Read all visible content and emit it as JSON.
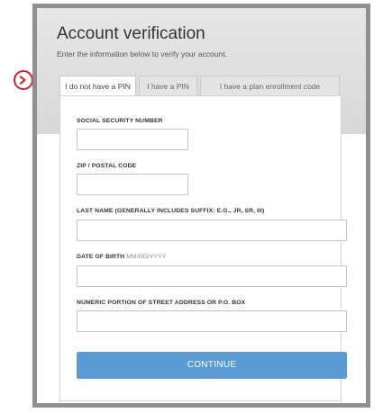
{
  "header": {
    "title": "Account verification",
    "subtitle": "Enter the information below to verify your account."
  },
  "tabs": [
    {
      "label": "I do not have a PIN",
      "active": true
    },
    {
      "label": "I have a PIN",
      "active": false
    },
    {
      "label": "I have a plan enrollment code",
      "active": false
    }
  ],
  "form": {
    "ssn_label": "SOCIAL SECURITY NUMBER",
    "ssn_value": "",
    "zip_label": "ZIP / POSTAL CODE",
    "zip_value": "",
    "last_name_label": "LAST NAME (GENERALLY INCLUDES SUFFIX: E.G., JR, SR, III)",
    "last_name_value": "",
    "dob_label": "DATE OF BIRTH",
    "dob_hint": "MM/DD/YYYY",
    "dob_value": "",
    "street_label": "NUMERIC PORTION OF STREET ADDRESS OR P.O. BOX",
    "street_value": "",
    "continue_label": "CONTINUE"
  },
  "colors": {
    "accent": "#5b9bd5",
    "marker": "#d0202c",
    "frame": "#8f8f8f"
  },
  "icons": {
    "marker": "chevron-right-icon"
  }
}
